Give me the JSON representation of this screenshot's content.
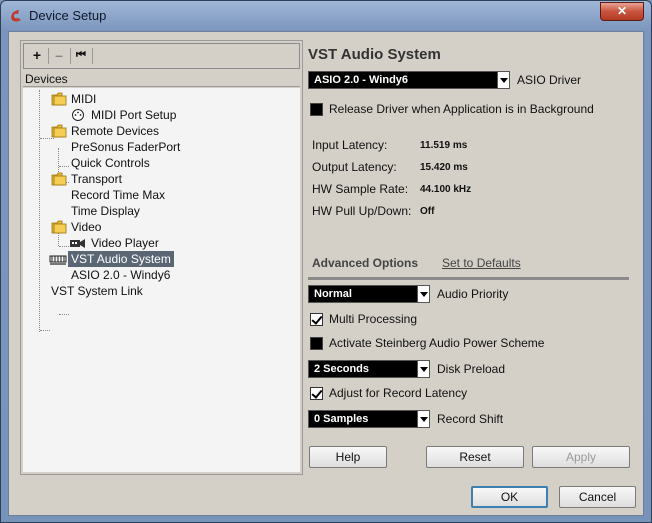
{
  "window": {
    "title": "Device Setup"
  },
  "toolbar": {
    "add": "+",
    "remove": "–",
    "reset": "⏮"
  },
  "devices_header": "Devices",
  "tree": [
    {
      "label": "MIDI",
      "icon": "folder-icon"
    },
    {
      "label": "MIDI Port Setup",
      "icon": "midi-port-icon"
    },
    {
      "label": "Remote Devices",
      "icon": "folder-icon"
    },
    {
      "label": "PreSonus FaderPort",
      "icon": ""
    },
    {
      "label": "Quick Controls",
      "icon": ""
    },
    {
      "label": "Transport",
      "icon": "folder-icon"
    },
    {
      "label": "Record Time Max",
      "icon": ""
    },
    {
      "label": "Time Display",
      "icon": ""
    },
    {
      "label": "Video",
      "icon": "folder-icon"
    },
    {
      "label": "Video Player",
      "icon": "video-player-icon"
    },
    {
      "label": "VST Audio System",
      "icon": "vst-audio-icon",
      "selected": true
    },
    {
      "label": "ASIO 2.0 - Windy6",
      "icon": ""
    },
    {
      "label": "VST System Link",
      "icon": ""
    }
  ],
  "main": {
    "heading": "VST Audio System",
    "asio_driver": {
      "value": "ASIO 2.0 - Windy6",
      "label": "ASIO Driver"
    },
    "release_driver": {
      "label": "Release Driver when Application is in Background",
      "checked": false
    },
    "info": [
      {
        "label": "Input Latency:",
        "value": "11.519 ms"
      },
      {
        "label": "Output Latency:",
        "value": "15.420 ms"
      },
      {
        "label": "HW Sample Rate:",
        "value": "44.100 kHz"
      },
      {
        "label": "HW Pull Up/Down:",
        "value": "Off"
      }
    ],
    "advanced_label": "Advanced Options",
    "set_defaults": "Set to Defaults",
    "audio_priority": {
      "value": "Normal",
      "label": "Audio Priority"
    },
    "multi_processing": {
      "label": "Multi Processing",
      "checked": true
    },
    "steinberg_power": {
      "label": "Activate Steinberg Audio Power Scheme",
      "checked": false
    },
    "disk_preload": {
      "value": "2 Seconds",
      "label": "Disk Preload"
    },
    "adjust_latency": {
      "label": "Adjust for Record Latency",
      "checked": true
    },
    "record_shift": {
      "value": "0 Samples",
      "label": "Record Shift"
    }
  },
  "buttons": {
    "help": "Help",
    "reset": "Reset",
    "apply": "Apply",
    "ok": "OK",
    "cancel": "Cancel"
  },
  "colors": {
    "selection": "#5b6675",
    "close": "#c9533d",
    "ok_border": "#3c7fb1"
  }
}
